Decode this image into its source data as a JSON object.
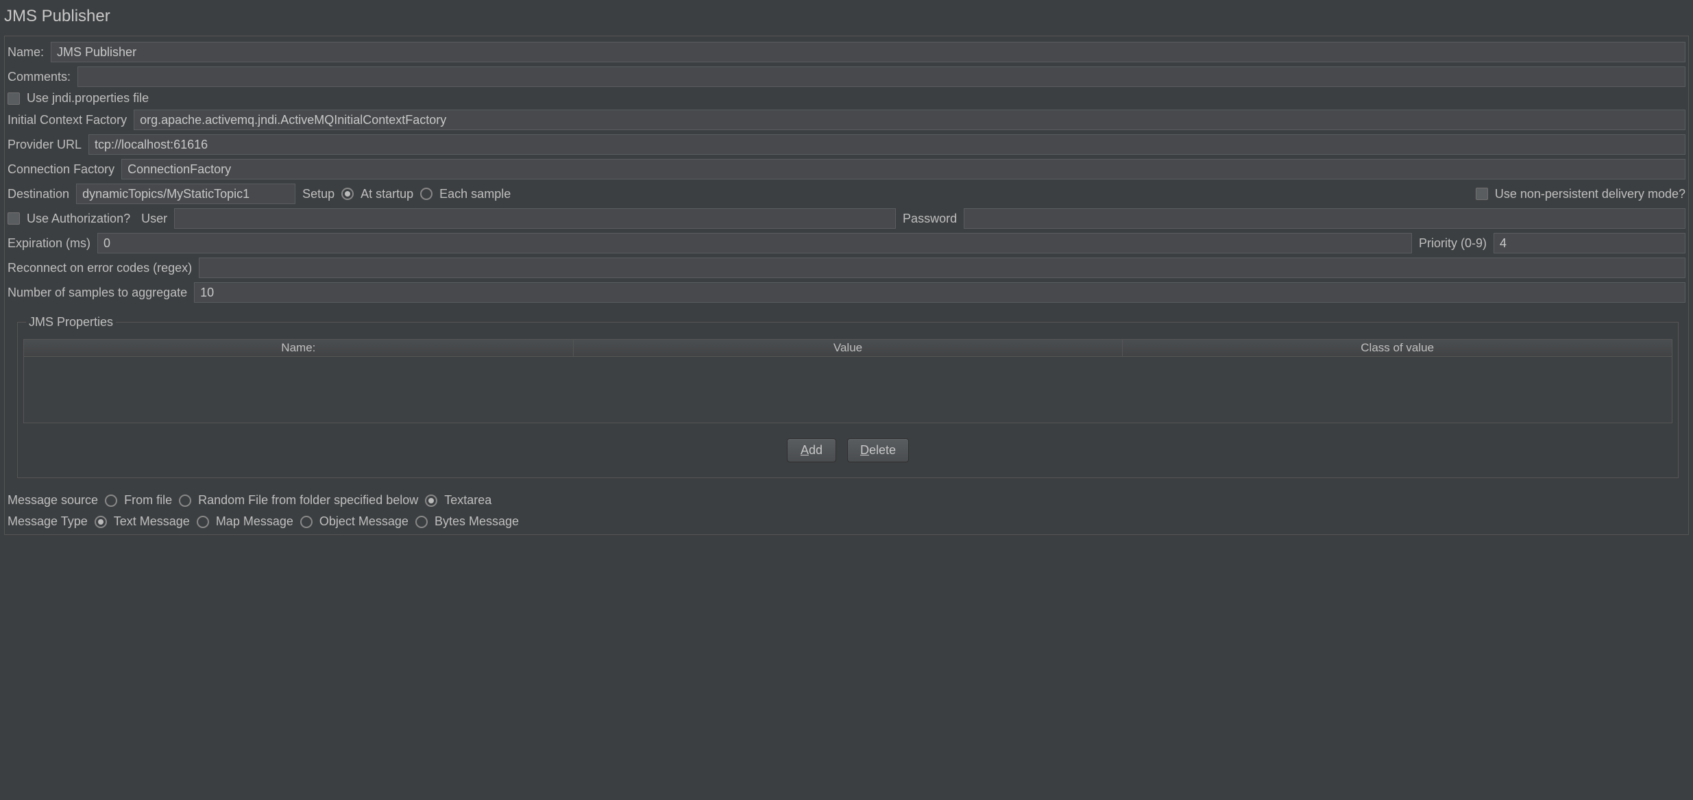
{
  "title": "JMS Publisher",
  "name": {
    "label": "Name:",
    "value": "JMS Publisher"
  },
  "comments": {
    "label": "Comments:",
    "value": ""
  },
  "useJndi": {
    "label": "Use jndi.properties file",
    "checked": false
  },
  "initialContextFactory": {
    "label": "Initial Context Factory",
    "value": "org.apache.activemq.jndi.ActiveMQInitialContextFactory"
  },
  "providerUrl": {
    "label": "Provider URL",
    "value": "tcp://localhost:61616"
  },
  "connectionFactory": {
    "label": "Connection Factory",
    "value": "ConnectionFactory"
  },
  "destination": {
    "label": "Destination",
    "value": "dynamicTopics/MyStaticTopic1"
  },
  "setup": {
    "label": "Setup",
    "options": [
      "At startup",
      "Each sample"
    ],
    "selected": "At startup"
  },
  "nonPersistent": {
    "label": "Use non-persistent delivery mode?",
    "checked": false
  },
  "useAuth": {
    "label": "Use Authorization?",
    "checked": false
  },
  "user": {
    "label": "User",
    "value": ""
  },
  "password": {
    "label": "Password",
    "value": ""
  },
  "expiration": {
    "label": "Expiration (ms)",
    "value": "0"
  },
  "priority": {
    "label": "Priority (0-9)",
    "value": "4"
  },
  "reconnect": {
    "label": "Reconnect on error codes (regex)",
    "value": ""
  },
  "aggregate": {
    "label": "Number of samples to aggregate",
    "value": "10"
  },
  "jmsProps": {
    "legend": "JMS Properties",
    "columns": [
      "Name:",
      "Value",
      "Class of value"
    ],
    "rows": [],
    "addBtn": "Add",
    "deleteBtn": "Delete"
  },
  "messageSource": {
    "label": "Message source",
    "options": [
      "From file",
      "Random File from folder specified below",
      "Textarea"
    ],
    "selected": "Textarea"
  },
  "messageType": {
    "label": "Message Type",
    "options": [
      "Text Message",
      "Map Message",
      "Object Message",
      "Bytes Message"
    ],
    "selected": "Text Message"
  }
}
